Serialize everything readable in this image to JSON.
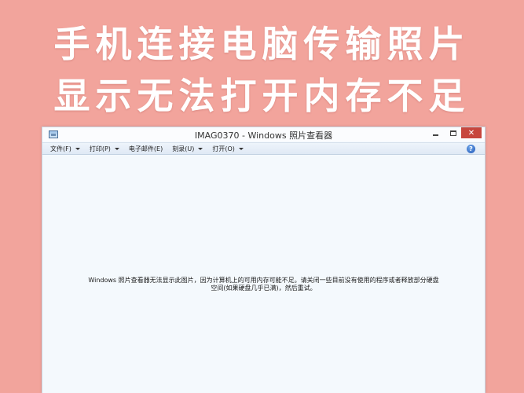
{
  "headline": {
    "line1": "手机连接电脑传输照片",
    "line2": "显示无法打开内存不足"
  },
  "window": {
    "title": "IMAG0370 - Windows 照片查看器",
    "controls": {
      "minimize": "minimize",
      "maximize": "maximize",
      "close": "✕"
    },
    "menu": [
      {
        "label": "文件(F)"
      },
      {
        "label": "打印(P)"
      },
      {
        "label": "电子邮件(E)"
      },
      {
        "label": "刻录(U)"
      },
      {
        "label": "打开(O)"
      }
    ],
    "help_label": "?",
    "message_line1": "Windows 照片查看器无法显示此图片，因为计算机上的可用内存可能不足。请关闭一些目前没有使用的程序或者释放部分硬盘",
    "message_line2": "空间(如果硬盘几乎已满)，然后重试。"
  },
  "colors": {
    "background": "#f2a49c",
    "window_bg": "#f4f9fd",
    "close_button": "#c7463d"
  }
}
